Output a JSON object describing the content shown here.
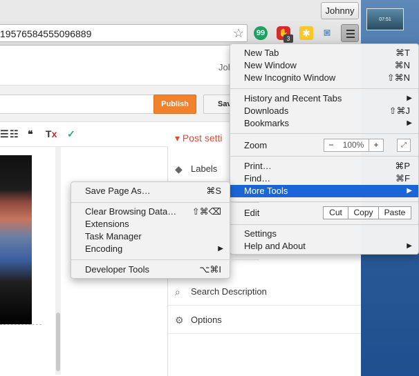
{
  "profile": {
    "name": "Johnny"
  },
  "desktop": {
    "thumbnail_time": "07:51"
  },
  "toolbar": {
    "url_fragment": "19576584555096889",
    "bookmark_star": "☆",
    "ext_badge_count": "3",
    "icons": [
      "evernote-icon",
      "adblock-icon",
      "ext-yellow-icon",
      "camera-icon",
      "chrome-menu-icon"
    ]
  },
  "page": {
    "user_label": "Joh",
    "publish_label": "Publish",
    "save_label": "Sav",
    "post_settings_title": "Post setti",
    "settings_items": [
      {
        "label": "Labels",
        "icon": "tag-icon"
      },
      {
        "label": "Search Description",
        "icon": "search-icon"
      },
      {
        "label": "Options",
        "icon": "gear-icon"
      }
    ]
  },
  "chrome_menu": {
    "new_tab": {
      "label": "New Tab",
      "shortcut": "⌘T"
    },
    "new_window": {
      "label": "New Window",
      "shortcut": "⌘N"
    },
    "new_incognito": {
      "label": "New Incognito Window",
      "shortcut": "⇧⌘N"
    },
    "history": {
      "label": "History and Recent Tabs"
    },
    "downloads": {
      "label": "Downloads",
      "shortcut": "⇧⌘J"
    },
    "bookmarks": {
      "label": "Bookmarks"
    },
    "zoom": {
      "label": "Zoom",
      "minus": "−",
      "value": "100%",
      "plus": "+"
    },
    "print": {
      "label": "Print…",
      "shortcut": "⌘P"
    },
    "find": {
      "label": "Find…",
      "shortcut": "⌘F"
    },
    "more_tools": {
      "label": "More Tools"
    },
    "edit": {
      "label": "Edit",
      "cut": "Cut",
      "copy": "Copy",
      "paste": "Paste"
    },
    "settings": {
      "label": "Settings"
    },
    "help": {
      "label": "Help and About"
    }
  },
  "more_tools_menu": {
    "save_page": {
      "label": "Save Page As…",
      "shortcut": "⌘S"
    },
    "clear_browsing": {
      "label": "Clear Browsing Data…",
      "shortcut": "⇧⌘⌫"
    },
    "extensions": {
      "label": "Extensions"
    },
    "task_manager": {
      "label": "Task Manager"
    },
    "encoding": {
      "label": "Encoding"
    },
    "developer_tools": {
      "label": "Developer Tools",
      "shortcut": "⌥⌘I"
    }
  },
  "colors": {
    "menu_highlight": "#1a66d8",
    "publish": "#f0812d",
    "post_settings": "#dd4b39"
  }
}
